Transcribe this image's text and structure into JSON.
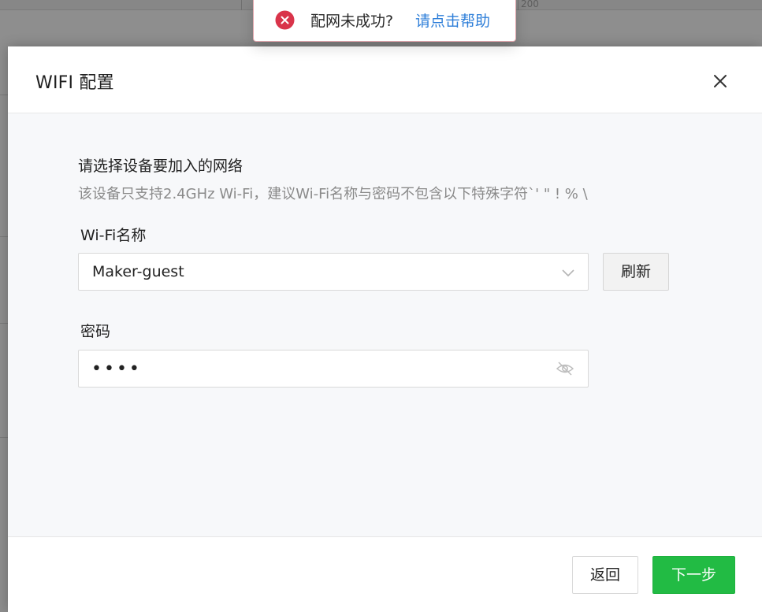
{
  "background": {
    "ruler_label": "200"
  },
  "toast": {
    "message": "配网未成功?",
    "link": "请点击帮助",
    "icon": "error-circle-icon",
    "color": "#d9344a"
  },
  "modal": {
    "title": "WIFI 配置",
    "close_icon": "close-icon",
    "section_title": "请选择设备要加入的网络",
    "section_subtitle": "该设备只支持2.4GHz Wi-Fi，建议Wi-Fi名称与密码不包含以下特殊字符`' \" ! % \\",
    "wifi_label": "Wi-Fi名称",
    "wifi_selected": "Maker-guest",
    "refresh_label": "刷新",
    "password_label": "密码",
    "password_value": "••••",
    "eye_icon": "eye-hidden-icon"
  },
  "footer": {
    "back_label": "返回",
    "next_label": "下一步",
    "accent_color": "#22bb44"
  }
}
